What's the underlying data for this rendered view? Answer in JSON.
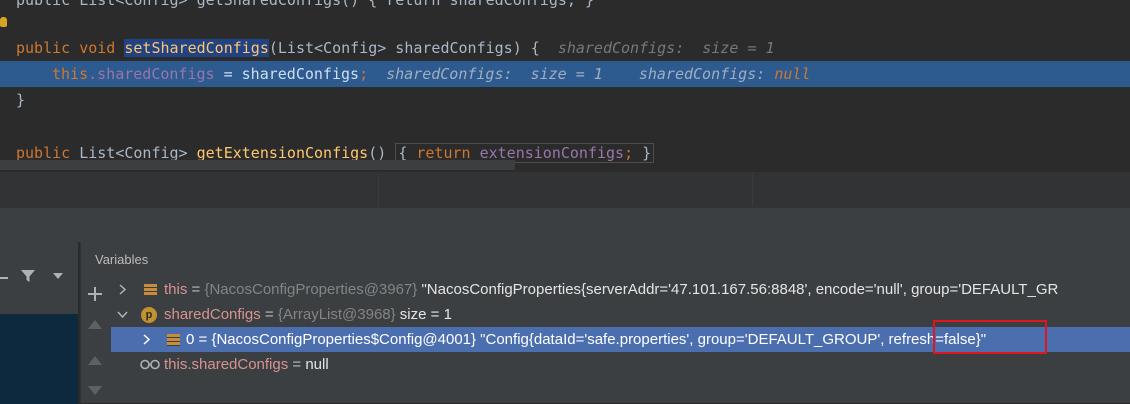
{
  "editor": {
    "line0": "public List<Config> getSharedConfigs() { return sharedConfigs; }",
    "line1": {
      "kw1": "public",
      "kw2": "void",
      "method": "setSharedConfigs",
      "params": "(List<Config> sharedConfigs) {",
      "hint": "sharedConfigs:  size = 1"
    },
    "line2": {
      "this_kw": "this",
      "field": ".sharedConfigs",
      "rest": " = sharedConfigs",
      "semi": ";",
      "hint1": "sharedConfigs:  size = 1",
      "hint2_label": "sharedConfigs: ",
      "hint2_val": "null"
    },
    "line3": "}",
    "line5": {
      "kw1": "public",
      "type": " List<Config> ",
      "method": "getExtensionConfigs",
      "paren": "() ",
      "brace": "{",
      "ret": "return",
      "field": "extensionConfigs",
      "semi": ";",
      "close": "}"
    }
  },
  "variables_panel": {
    "title": "Variables",
    "rows": [
      {
        "name": "this",
        "eq": " = ",
        "type": "{NacosConfigProperties@3967}",
        "value": " \"NacosConfigProperties{serverAddr='47.101.167.56:8848', encode='null', group='DEFAULT_GR"
      },
      {
        "name": "sharedConfigs",
        "eq": " = ",
        "type": "{ArrayList@3968}",
        "value": "  size = 1"
      },
      {
        "name": "0",
        "eq": " = ",
        "type": "{NacosConfigProperties$Config@4001}",
        "value": " \"Config{dataId='safe.properties', group='DEFAULT_GROUP', refresh=false}\""
      },
      {
        "name": "this.sharedConfigs",
        "eq": " = ",
        "value": "null"
      }
    ]
  },
  "icons": {
    "add": "+",
    "filter": "filter-icon",
    "up": "up-arrow",
    "down": "down-arrow"
  },
  "colors": {
    "highlight_line": "#2d5a8f",
    "selected_row": "#4b6eaf",
    "annotation": "#e0161f"
  }
}
